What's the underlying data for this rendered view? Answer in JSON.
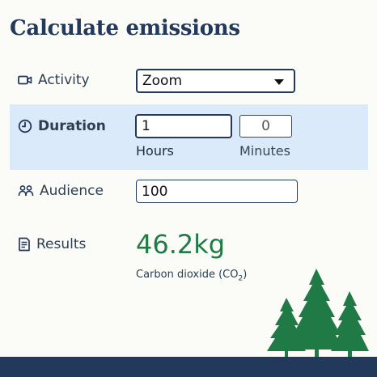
{
  "page": {
    "title": "Calculate emissions"
  },
  "activity": {
    "label": "Activity",
    "icon": "video-camera-icon",
    "value": "Zoom"
  },
  "duration": {
    "label": "Duration",
    "icon": "clock-icon",
    "hours_value": "1",
    "hours_label": "Hours",
    "minutes_value": "0",
    "minutes_label": "Minutes",
    "highlight_color": "#dbeafa"
  },
  "audience": {
    "label": "Audience",
    "icon": "people-icon",
    "value": "100"
  },
  "results": {
    "label": "Results",
    "icon": "document-icon",
    "value": "46.2kg",
    "value_color": "#1f7a45",
    "unit_prefix": "Carbon dioxide (CO",
    "unit_subscript": "2",
    "unit_suffix": ")"
  },
  "theme": {
    "accent": "#23395b",
    "tree_color": "#1f7a45"
  }
}
